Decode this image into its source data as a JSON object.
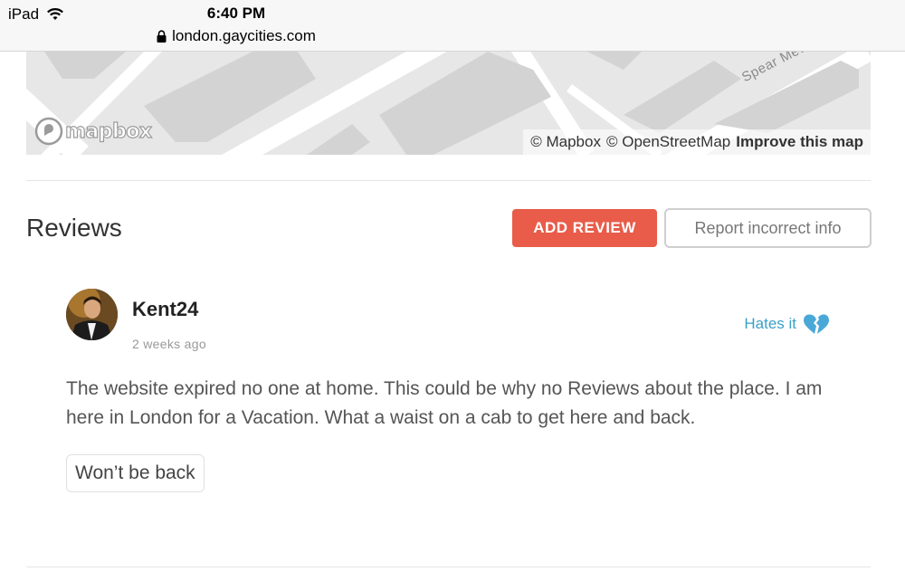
{
  "status_bar": {
    "device": "iPad",
    "time": "6:40 PM"
  },
  "browser": {
    "url": "london.gaycities.com"
  },
  "map": {
    "logo": "mapbox",
    "street_label": "Spear Mews",
    "attribution": {
      "mapbox": "© Mapbox",
      "osm": "© OpenStreetMap",
      "improve": "Improve this map"
    }
  },
  "reviews": {
    "title": "Reviews",
    "add_review_label": "ADD REVIEW",
    "report_label": "Report incorrect info",
    "items": [
      {
        "username": "Kent24",
        "time_ago": "2 weeks ago",
        "rating_text": "Hates it",
        "rating_icon": "broken-heart-icon",
        "text": "The website expired no one at home. This could be why no Reviews about the place. I am here in London for a Vacation. What a waist on a cab to get here and back.",
        "tag": "Won’t be back"
      }
    ]
  },
  "colors": {
    "accent_button": "#e85c49",
    "rating": "#3aa0c9"
  }
}
